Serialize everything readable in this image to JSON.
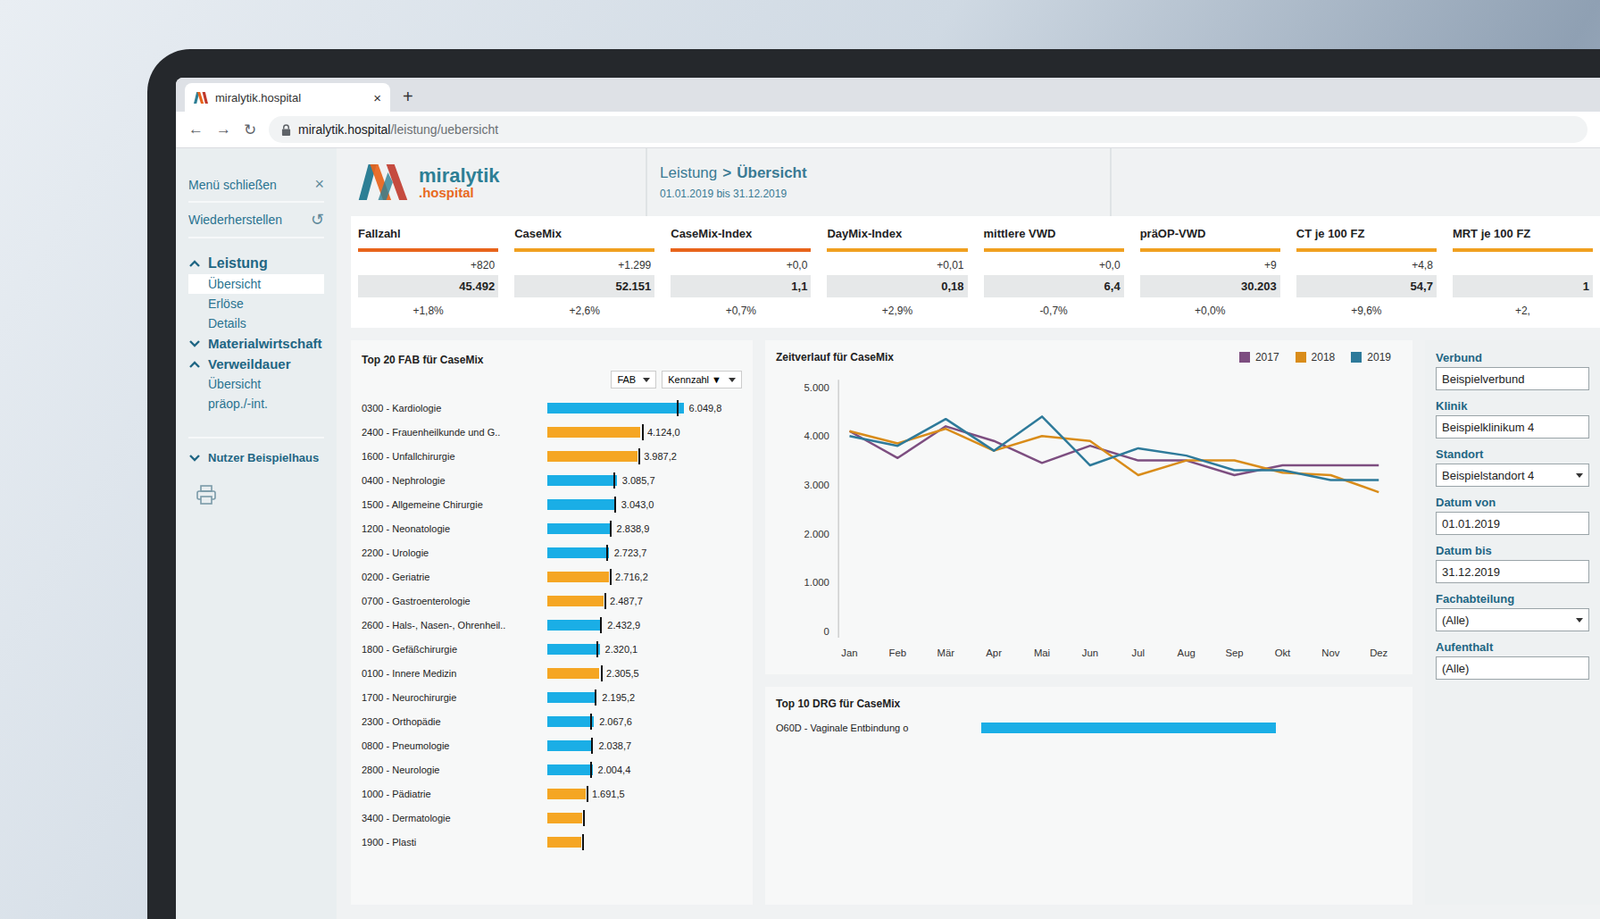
{
  "browser": {
    "tab_title": "miralytik.hospital",
    "tab_close": "×",
    "new_tab": "+",
    "nav": [
      "←",
      "→",
      "↻"
    ],
    "url_host": "miralytik.hospital",
    "url_path": "/leistung/uebersicht"
  },
  "logo": {
    "name": "miralytik",
    "suffix": ".hospital"
  },
  "header": {
    "breadcrumb": [
      "Leistung",
      "Übersicht"
    ],
    "separator": ">",
    "date_range": "01.01.2019 bis 31.12.2019"
  },
  "sidebar": {
    "actions": [
      {
        "label": "Menü schließen",
        "icon": "×"
      },
      {
        "label": "Wiederherstellen",
        "icon": "↺"
      }
    ],
    "sections": [
      {
        "label": "Leistung",
        "expanded": true,
        "items": [
          {
            "label": "Übersicht",
            "selected": true
          },
          {
            "label": "Erlöse",
            "selected": false
          },
          {
            "label": "Details",
            "selected": false
          }
        ]
      },
      {
        "label": "Materialwirtschaft",
        "expanded": false,
        "items": []
      },
      {
        "label": "Verweildauer",
        "expanded": true,
        "items": [
          {
            "label": "Übersicht",
            "selected": false
          },
          {
            "label": "präop./-int.",
            "selected": false
          }
        ]
      }
    ],
    "user": {
      "label": "Nutzer Beispielhaus",
      "expanded": false
    }
  },
  "kpis": [
    {
      "label": "Fallzahl",
      "delta_abs": "+820",
      "value": "45.492",
      "delta_pct": "+1,8%",
      "color": "#e8641b"
    },
    {
      "label": "CaseMix",
      "delta_abs": "+1.299",
      "value": "52.151",
      "delta_pct": "+2,6%",
      "color": "#f0a020"
    },
    {
      "label": "CaseMix-Index",
      "delta_abs": "+0,0",
      "value": "1,1",
      "delta_pct": "+0,7%",
      "color": "#e8641b"
    },
    {
      "label": "DayMix-Index",
      "delta_abs": "+0,01",
      "value": "0,18",
      "delta_pct": "+2,9%",
      "color": "#f0a020"
    },
    {
      "label": "mittlere VWD",
      "delta_abs": "+0,0",
      "value": "6,4",
      "delta_pct": "-0,7%",
      "color": "#f0a020"
    },
    {
      "label": "präOP-VWD",
      "delta_abs": "+9",
      "value": "30.203",
      "delta_pct": "+0,0%",
      "color": "#f0a020"
    },
    {
      "label": "CT je 100 FZ",
      "delta_abs": "+4,8",
      "value": "54,7",
      "delta_pct": "+9,6%",
      "color": "#f0a020"
    },
    {
      "label": "MRT je 100 FZ",
      "delta_abs": "",
      "value": "1",
      "delta_pct": "+2,",
      "color": "#f0a020"
    }
  ],
  "fab_chart": {
    "title": "Top 20 FAB für CaseMix",
    "controls": [
      {
        "label": "FAB"
      },
      {
        "label": "Kennzahl ▼"
      }
    ],
    "rows": [
      {
        "label": "0300 - Kardiologie",
        "value": 6049.8,
        "marker": 5750,
        "reading": "6.049,8",
        "color": "#1aaee6"
      },
      {
        "label": "2400 - Frauenheilkunde und G..",
        "value": 4124.0,
        "marker": 4200,
        "reading": "4.124,0",
        "color": "#f5a623"
      },
      {
        "label": "1600 - Unfallchirurgie",
        "value": 3987.2,
        "marker": 4050,
        "reading": "3.987,2",
        "color": "#f5a623"
      },
      {
        "label": "0400 - Nephrologie",
        "value": 3085.7,
        "marker": 2950,
        "reading": "3.085,7",
        "color": "#1aaee6"
      },
      {
        "label": "1500 - Allgemeine Chirurgie",
        "value": 3043.0,
        "marker": 2960,
        "reading": "3.043,0",
        "color": "#1aaee6"
      },
      {
        "label": "1200 - Neonatologie",
        "value": 2838.9,
        "marker": 2760,
        "reading": "2.838,9",
        "color": "#1aaee6"
      },
      {
        "label": "2200 - Urologie",
        "value": 2723.7,
        "marker": 2600,
        "reading": "2.723,7",
        "color": "#1aaee6"
      },
      {
        "label": "0200 - Geriatrie",
        "value": 2716.2,
        "marker": 2780,
        "reading": "2.716,2",
        "color": "#f5a623"
      },
      {
        "label": "0700 - Gastroenterologie",
        "value": 2487.7,
        "marker": 2540,
        "reading": "2.487,7",
        "color": "#f5a623"
      },
      {
        "label": "2600 - Hals-, Nasen-, Ohrenheil..",
        "value": 2432.9,
        "marker": 2330,
        "reading": "2.432,9",
        "color": "#1aaee6"
      },
      {
        "label": "1800 - Gefäßchirurgie",
        "value": 2320.1,
        "marker": 2200,
        "reading": "2.320,1",
        "color": "#1aaee6"
      },
      {
        "label": "0100 - Innere Medizin",
        "value": 2305.5,
        "marker": 2380,
        "reading": "2.305,5",
        "color": "#f5a623"
      },
      {
        "label": "1700 - Neurochirurgie",
        "value": 2195.2,
        "marker": 2110,
        "reading": "2.195,2",
        "color": "#1aaee6"
      },
      {
        "label": "2300 - Orthopädie",
        "value": 2067.6,
        "marker": 1900,
        "reading": "2.067,6",
        "color": "#1aaee6"
      },
      {
        "label": "0800 - Pneumologie",
        "value": 2038.7,
        "marker": 1960,
        "reading": "2.038,7",
        "color": "#1aaee6"
      },
      {
        "label": "2800 - Neurologie",
        "value": 2004.4,
        "marker": 1910,
        "reading": "2.004,4",
        "color": "#1aaee6"
      },
      {
        "label": "1000 - Pädiatrie",
        "value": 1691.5,
        "marker": 1740,
        "reading": "1.691,5",
        "color": "#f5a623"
      },
      {
        "label": "3400 - Dermatologie",
        "value": 1560,
        "marker": 1600,
        "color": "#f5a623"
      },
      {
        "label": "1900 - Plasti",
        "value": 1500,
        "marker": 1550,
        "color": "#f5a623"
      }
    ]
  },
  "line_chart": {
    "title": "Zeitverlauf für CaseMix",
    "y_ticks": [
      "5.000",
      "4.000",
      "3.000",
      "2.000",
      "1.000",
      "0"
    ],
    "months": [
      "Jan",
      "Feb",
      "Mär",
      "Apr",
      "Mai",
      "Jun",
      "Jul",
      "Aug",
      "Sep",
      "Okt",
      "Nov",
      "Dez"
    ],
    "series": [
      {
        "name": "2017",
        "color": "#7d4e80",
        "values": [
          4100,
          3550,
          4200,
          3900,
          3450,
          3800,
          3500,
          3500,
          3200,
          3400,
          3400,
          3400
        ]
      },
      {
        "name": "2018",
        "color": "#d98c1a",
        "values": [
          4100,
          3850,
          4150,
          3700,
          4000,
          3900,
          3200,
          3500,
          3500,
          3250,
          3200,
          2850
        ]
      },
      {
        "name": "2019",
        "color": "#2e7a9a",
        "values": [
          4000,
          3800,
          4350,
          3700,
          4400,
          3400,
          3750,
          3600,
          3300,
          3300,
          3100,
          3100
        ]
      }
    ]
  },
  "drg_chart": {
    "title": "Top 10 DRG für CaseMix",
    "rows": [
      {
        "label": "O60D - Vaginale Entbindung o",
        "value": 1150,
        "color": "#1aaee6"
      }
    ]
  },
  "filters": [
    {
      "label": "Verbund",
      "value": "Beispielverbund",
      "dropdown": false
    },
    {
      "label": "Klinik",
      "value": "Beispielklinikum 4",
      "dropdown": false
    },
    {
      "label": "Standort",
      "value": "Beispielstandort 4",
      "dropdown": true
    },
    {
      "label": "Datum von",
      "value": "01.01.2019",
      "dropdown": false
    },
    {
      "label": "Datum bis",
      "value": "31.12.2019",
      "dropdown": false
    },
    {
      "label": "Fachabteilung",
      "value": "(Alle)",
      "dropdown": true
    },
    {
      "label": "Aufenthalt",
      "value": "(Alle)",
      "dropdown": false
    }
  ]
}
